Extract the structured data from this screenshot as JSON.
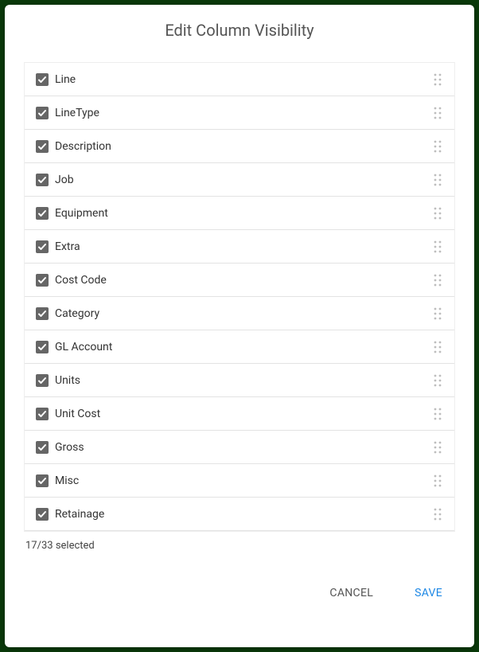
{
  "dialog": {
    "title": "Edit Column Visibility",
    "status_text": "17/33 selected",
    "cancel_label": "CANCEL",
    "save_label": "SAVE"
  },
  "columns": [
    {
      "label": "Line",
      "checked": true
    },
    {
      "label": "LineType",
      "checked": true
    },
    {
      "label": "Description",
      "checked": true
    },
    {
      "label": "Job",
      "checked": true
    },
    {
      "label": "Equipment",
      "checked": true
    },
    {
      "label": "Extra",
      "checked": true
    },
    {
      "label": "Cost Code",
      "checked": true
    },
    {
      "label": "Category",
      "checked": true
    },
    {
      "label": "GL Account",
      "checked": true
    },
    {
      "label": "Units",
      "checked": true
    },
    {
      "label": "Unit Cost",
      "checked": true
    },
    {
      "label": "Gross",
      "checked": true
    },
    {
      "label": "Misc",
      "checked": true
    },
    {
      "label": "Retainage",
      "checked": true
    }
  ]
}
